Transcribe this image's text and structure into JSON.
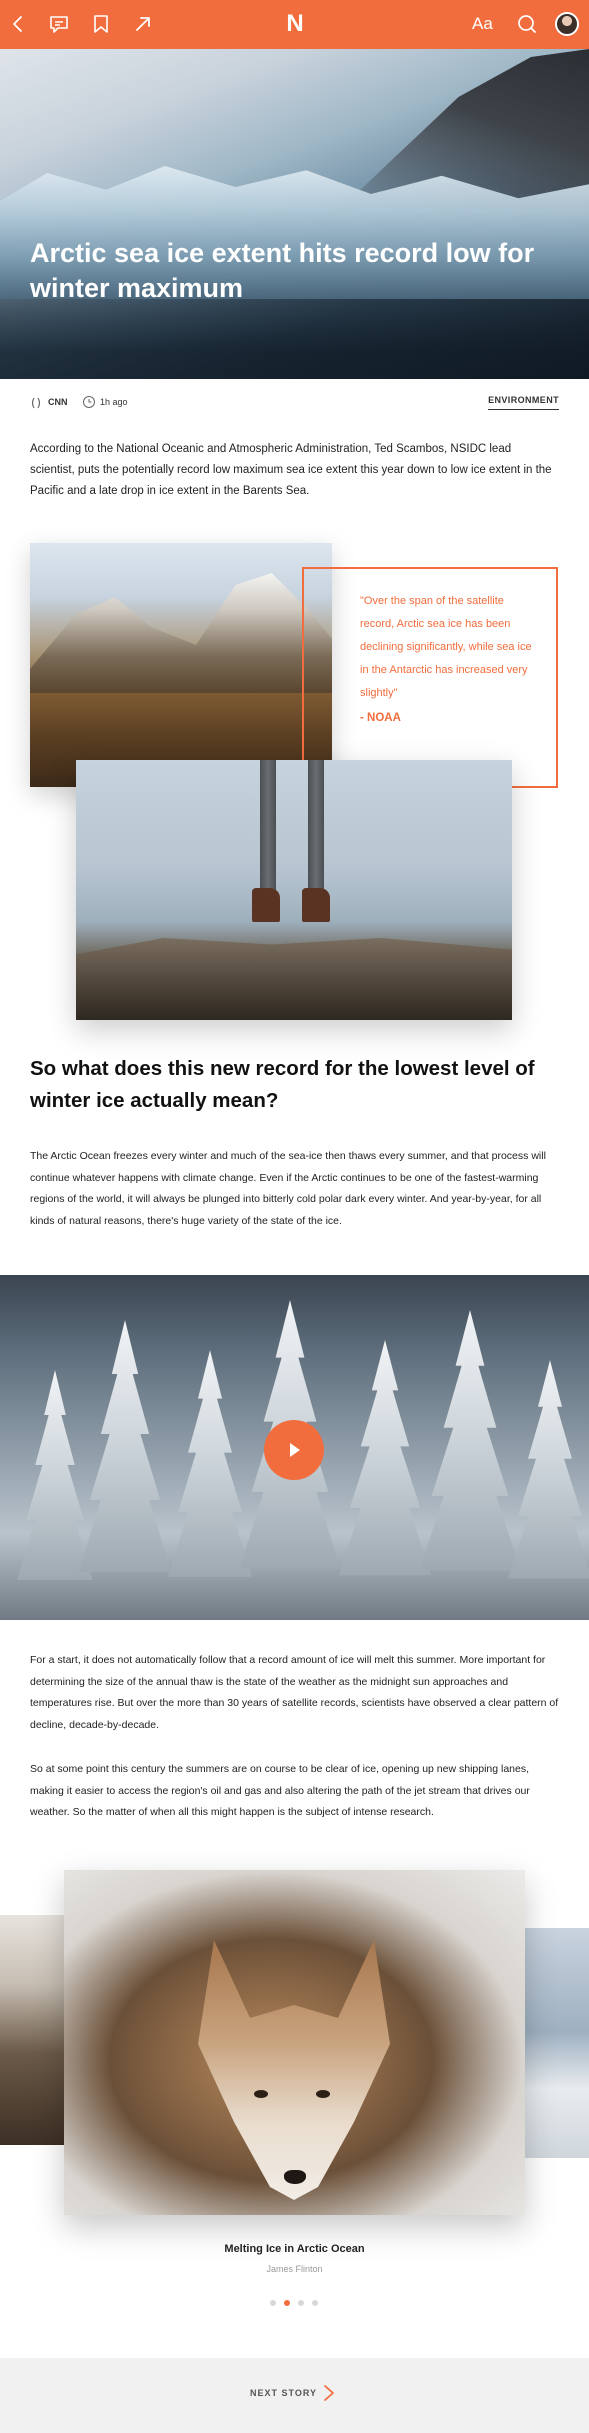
{
  "brand": {
    "accent": "#f26d3d",
    "logo_letter": "N"
  },
  "topbar": {
    "icons": [
      "back-icon",
      "comment-icon",
      "bookmark-icon",
      "share-icon",
      "text-size-icon",
      "search-icon",
      "avatar"
    ],
    "text_size_label": "Aa"
  },
  "hero": {
    "title": "Arctic sea ice extent hits record low for winter maximum"
  },
  "meta": {
    "source": "CNN",
    "time": "1h ago",
    "category": "ENVIRONMENT"
  },
  "body": {
    "intro": "According to the National Oceanic and Atmospheric Administration, Ted Scambos, NSIDC lead scientist, puts the potentially record low maximum sea ice extent this year down to low ice extent in the Pacific and a late drop in ice extent in the Barents Sea.",
    "quote": "\"Over the span of the satellite record, Arctic sea ice has been declining significantly, while sea ice in the Antarctic has increased very slightly\"",
    "quote_source": "- NOAA",
    "heading": "So what does this new record for the lowest level of winter ice actually mean?",
    "para1": "The Arctic Ocean freezes every winter and much of the sea-ice then thaws every summer, and that process will continue whatever happens with climate change. Even if the Arctic continues to be one of the fastest-warming regions of the world, it will always be plunged into bitterly cold polar dark every winter. And year-by-year, for all kinds of natural reasons, there's huge variety of the state of the ice.",
    "para2": "For a start, it does not automatically follow that a record amount of ice will melt this summer. More important for determining the size of the annual thaw is the state of the weather as the midnight sun approaches and temperatures rise. But over the more than 30 years of satellite records, scientists have observed a clear pattern of decline, decade-by-decade.",
    "para3": "So at some point this century the summers are on course to be clear of ice, opening up new shipping lanes, making it easier to access the region's oil and gas and also altering the path of the jet stream that drives our weather. So the matter of when all this might happen is the subject of intense research."
  },
  "gallery": {
    "caption": "Melting Ice in Arctic Ocean",
    "credit": "James Flinton",
    "pages": 4,
    "active_page": 2
  },
  "footer": {
    "next_label": "NEXT STORY"
  }
}
